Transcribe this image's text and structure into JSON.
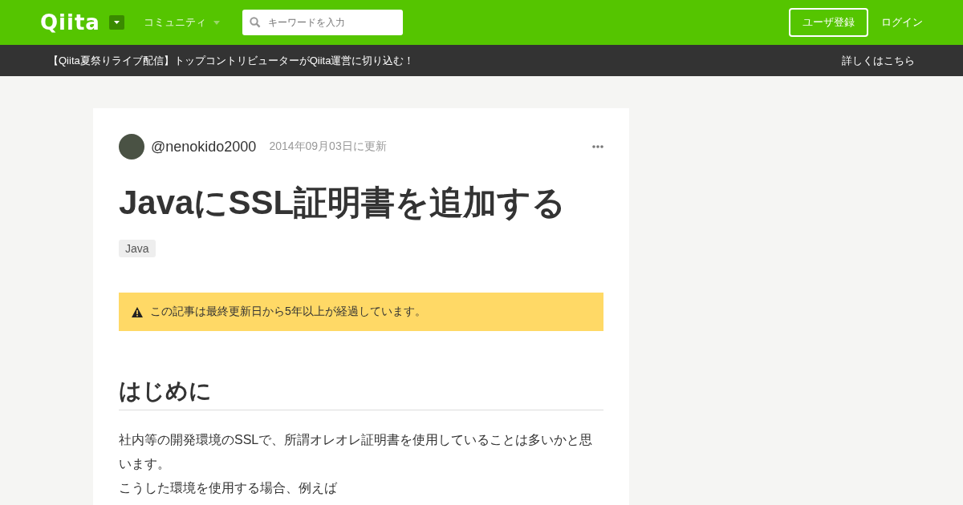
{
  "header": {
    "logo": "Qiita",
    "community_menu": "コミュニティ",
    "search": {
      "placeholder": "キーワードを入力"
    },
    "signup_button": "ユーザ登録",
    "login_link": "ログイン"
  },
  "announcement": {
    "text": "【Qiita夏祭りライブ配信】トップコントリビューターがQiita運営に切り込む！",
    "link": "詳しくはこちら"
  },
  "article": {
    "author": "@nenokido2000",
    "updated": "2014年09月03日に更新",
    "title": "JavaにSSL証明書を追加する",
    "tags": [
      "Java"
    ],
    "notice": "この記事は最終更新日から5年以上が経過しています。",
    "sections": [
      {
        "heading": "はじめに",
        "lines": [
          "社内等の開発環境のSSLで、所謂オレオレ証明書を使用していることは多いかと思います。",
          "こうした環境を使用する場合、例えば"
        ]
      }
    ]
  }
}
